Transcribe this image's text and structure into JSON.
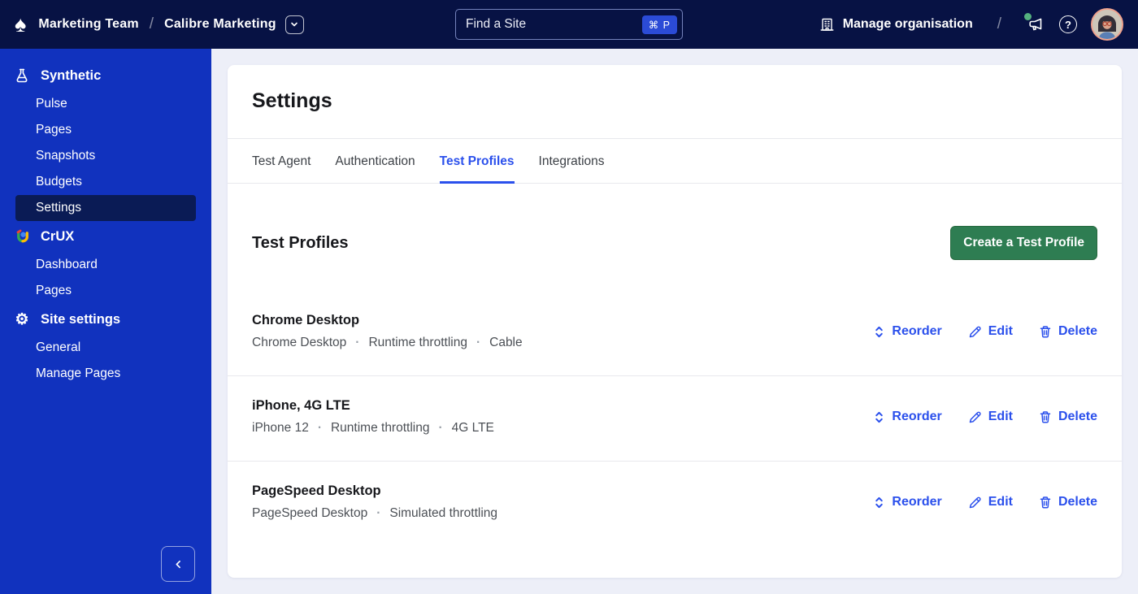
{
  "colors": {
    "topbar_bg": "#071244",
    "sidebar_bg": "#1132BE",
    "sidebar_active_bg": "#0A1B55",
    "main_bg": "#EDEFF8",
    "accent_blue": "#2B50EC",
    "button_green": "#2E7D52",
    "shortcut_badge_blue": "#2B4BD6"
  },
  "topbar": {
    "logo_glyph": "♠",
    "team_name": "Marketing Team",
    "separator": "/",
    "site_name": "Calibre Marketing",
    "search": {
      "placeholder": "Find a Site",
      "shortcut": "⌘ P"
    },
    "manage_org_label": "Manage organisation",
    "icons": [
      "building-icon",
      "megaphone-icon",
      "help-icon",
      "user-avatar"
    ]
  },
  "sidebar": {
    "sections": [
      {
        "label": "Synthetic",
        "icon": "flask-icon",
        "items": [
          {
            "label": "Pulse"
          },
          {
            "label": "Pages"
          },
          {
            "label": "Snapshots"
          },
          {
            "label": "Budgets"
          },
          {
            "label": "Settings",
            "active": true
          }
        ]
      },
      {
        "label": "CrUX",
        "icon": "crux-icon",
        "items": [
          {
            "label": "Dashboard"
          },
          {
            "label": "Pages"
          }
        ]
      },
      {
        "label": "Site settings",
        "icon": "gear-icon",
        "items": [
          {
            "label": "General"
          },
          {
            "label": "Manage Pages"
          }
        ]
      }
    ],
    "collapse_icon": "chevron-left-icon"
  },
  "main": {
    "page_title": "Settings",
    "tabs": [
      {
        "label": "Test Agent"
      },
      {
        "label": "Authentication"
      },
      {
        "label": "Test Profiles",
        "active": true
      },
      {
        "label": "Integrations"
      }
    ],
    "section_title": "Test Profiles",
    "create_button_label": "Create a Test Profile",
    "row_actions": {
      "reorder": "Reorder",
      "edit": "Edit",
      "delete": "Delete"
    },
    "profiles": [
      {
        "name": "Chrome Desktop",
        "details": {
          "0": "Chrome Desktop",
          "1": "Runtime throttling",
          "2": "Cable"
        }
      },
      {
        "name": "iPhone, 4G LTE",
        "details": {
          "0": "iPhone 12",
          "1": "Runtime throttling",
          "2": "4G LTE"
        }
      },
      {
        "name": "PageSpeed Desktop",
        "details": {
          "0": "PageSpeed Desktop",
          "1": "Simulated throttling"
        }
      }
    ]
  }
}
